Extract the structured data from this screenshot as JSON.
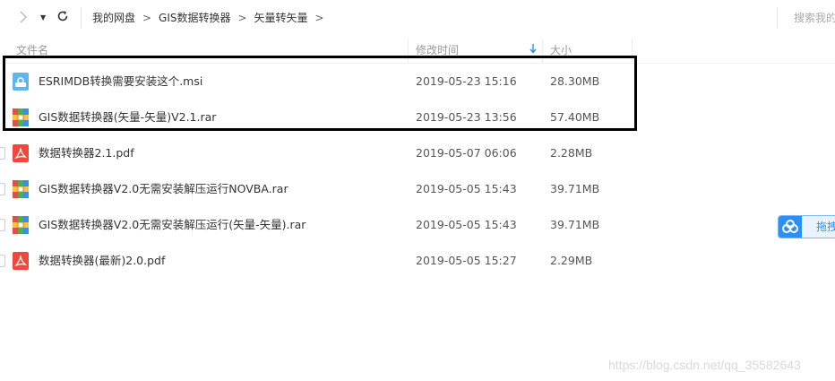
{
  "breadcrumb": {
    "items": [
      "我的网盘",
      "GIS数据转换器",
      "矢量转矢量"
    ],
    "separator": ">"
  },
  "search": {
    "placeholder": "搜索我的"
  },
  "table": {
    "columns": {
      "name": "文件名",
      "time": "修改时间",
      "size": "大小"
    },
    "rows": [
      {
        "name": "ESRIMDB转换需要安装这个.msi",
        "time": "2019-05-23 15:16",
        "size": "28.30MB",
        "icon": "msi-file-icon"
      },
      {
        "name": "GIS数据转换器(矢量-矢量)V2.1.rar",
        "time": "2019-05-23 13:56",
        "size": "57.40MB",
        "icon": "rar-file-icon"
      },
      {
        "name": "数据转换器2.1.pdf",
        "time": "2019-05-07 06:06",
        "size": "2.28MB",
        "icon": "pdf-file-icon"
      },
      {
        "name": "GIS数据转换器V2.0无需安装解压运行NOVBA.rar",
        "time": "2019-05-05 15:43",
        "size": "39.71MB",
        "icon": "rar-file-icon"
      },
      {
        "name": "GIS数据转换器V2.0无需安装解压运行(矢量-矢量).rar",
        "time": "2019-05-05 15:43",
        "size": "39.71MB",
        "icon": "rar-file-icon"
      },
      {
        "name": "数据转换器(最新)2.0.pdf",
        "time": "2019-05-05 15:27",
        "size": "2.29MB",
        "icon": "pdf-file-icon"
      }
    ]
  },
  "side_tab": {
    "label": "拖拽"
  },
  "watermark": "https://blog.csdn.net/qq_35582643",
  "colors": {
    "accent": "#2a8ff7",
    "pdf": "#f0463e",
    "msi": "#5ab7f0",
    "highlight": "#000000"
  }
}
